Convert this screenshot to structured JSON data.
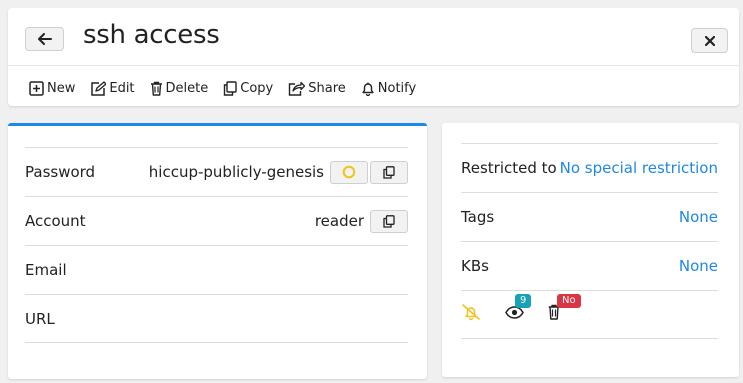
{
  "header": {
    "title": "ssh access",
    "back_icon": "arrow-left-icon",
    "close_icon": "close-icon"
  },
  "toolbar": {
    "items": [
      {
        "label": "New",
        "icon": "plus-square-icon"
      },
      {
        "label": "Edit",
        "icon": "edit-icon"
      },
      {
        "label": "Delete",
        "icon": "trash-icon"
      },
      {
        "label": "Copy",
        "icon": "copy-icon"
      },
      {
        "label": "Share",
        "icon": "share-icon"
      },
      {
        "label": "Notify",
        "icon": "bell-icon"
      }
    ]
  },
  "details": {
    "password_label": "Password",
    "password_value": "hiccup-publicly-genesis",
    "account_label": "Account",
    "account_value": "reader",
    "email_label": "Email",
    "url_label": "URL"
  },
  "meta": {
    "restricted_label": "Restricted to",
    "restricted_value": "No special restriction",
    "tags_label": "Tags",
    "tags_value": "None",
    "kbs_label": "KBs",
    "kbs_value": "None",
    "watchers_count": "9",
    "delete_badge": "No"
  },
  "colors": {
    "accent": "#1e88e5",
    "bell_off": "#f0c419",
    "badge_info": "#17a2b8",
    "badge_danger": "#dc3545"
  }
}
